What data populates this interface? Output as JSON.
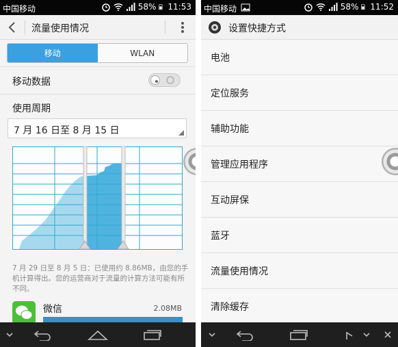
{
  "left": {
    "status": {
      "carrier": "中国移动",
      "battery": "58%",
      "time": "11:53"
    },
    "header": {
      "title": "流量使用情况"
    },
    "tabs": [
      {
        "label": "移动",
        "active": true
      },
      {
        "label": "WLAN",
        "active": false
      }
    ],
    "mobile_data": {
      "label": "移动数据",
      "enabled": false
    },
    "usage_cycle": {
      "label": "使用周期",
      "value": "7 月 16 日至 8 月 15 日"
    },
    "usage_note": "7 月 29 日至 8 月 5 日：已使用约 8.86MB，由您的手机计算得出。您的运营商对于流量的计算方法可能有所不同。",
    "apps": [
      {
        "name": "微信",
        "size": "2.08MB"
      }
    ]
  },
  "right": {
    "status": {
      "carrier": "中国移动",
      "battery": "58%",
      "time": "11:52"
    },
    "header": {
      "title": "设置快捷方式"
    },
    "items": [
      {
        "label": "电池"
      },
      {
        "label": "定位服务"
      },
      {
        "label": "辅助功能"
      },
      {
        "label": "管理应用程序"
      },
      {
        "label": "互动屏保"
      },
      {
        "label": "蓝牙"
      },
      {
        "label": "流量使用情况"
      },
      {
        "label": "清除缓存"
      }
    ]
  },
  "colors": {
    "accent": "#3aa0df",
    "chart_light": "#a6d9ee",
    "chart_dark": "#4fb3e0",
    "grid": "#32a7cf"
  },
  "icons": [
    "signal-icon",
    "wifi-icon",
    "battery-icon",
    "alarm-icon",
    "back-arrow-icon",
    "overflow-menu-icon",
    "settings-gear-icon",
    "nav-down-icon",
    "nav-back-icon",
    "nav-home-icon",
    "nav-recent-icon"
  ]
}
